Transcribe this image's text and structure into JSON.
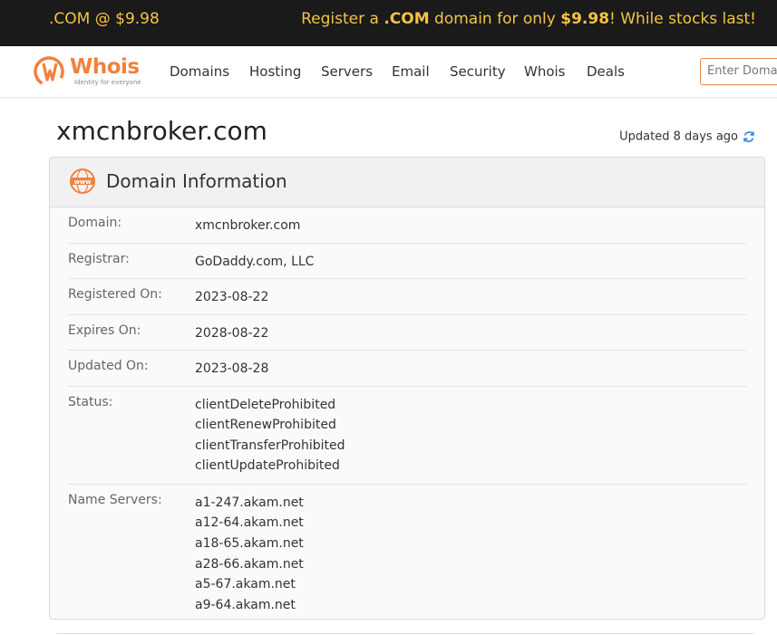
{
  "promo": {
    "left_text": ".COM @ $9.98",
    "right_pre": "Register a ",
    "right_tld": ".COM",
    "right_mid": " domain for only ",
    "right_price": "$9.98",
    "right_post": "! While stocks last!"
  },
  "brand": {
    "name": "Whois",
    "tagline": "Identity for everyone",
    "accent_color": "#f0813f"
  },
  "nav": {
    "items": [
      "Domains",
      "Hosting",
      "Servers",
      "Email",
      "Security",
      "Whois",
      "Deals"
    ],
    "search_placeholder": "Enter Domain"
  },
  "page": {
    "domain_title": "xmcnbroker.com",
    "updated_text": "Updated 8 days ago"
  },
  "domain_info": {
    "title": "Domain Information",
    "rows": [
      {
        "label": "Domain:",
        "values": [
          "xmcnbroker.com"
        ]
      },
      {
        "label": "Registrar:",
        "values": [
          "GoDaddy.com, LLC"
        ]
      },
      {
        "label": "Registered On:",
        "values": [
          "2023-08-22"
        ]
      },
      {
        "label": "Expires On:",
        "values": [
          "2028-08-22"
        ]
      },
      {
        "label": "Updated On:",
        "values": [
          "2023-08-28"
        ]
      },
      {
        "label": "Status:",
        "values": [
          "clientDeleteProhibited",
          "clientRenewProhibited",
          "clientTransferProhibited",
          "clientUpdateProhibited"
        ]
      },
      {
        "label": "Name Servers:",
        "values": [
          "a1-247.akam.net",
          "a12-64.akam.net",
          "a18-65.akam.net",
          "a28-66.akam.net",
          "a5-67.akam.net",
          "a9-64.akam.net"
        ]
      }
    ]
  }
}
